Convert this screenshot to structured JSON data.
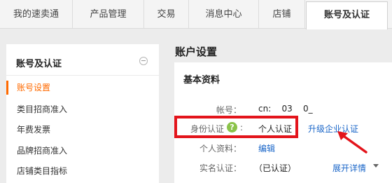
{
  "topnav": {
    "tabs": [
      {
        "label": "我的速卖通"
      },
      {
        "label": "产品管理"
      },
      {
        "label": "交易"
      },
      {
        "label": "消息中心"
      },
      {
        "label": "店铺"
      },
      {
        "label": "账号及认证",
        "active": true
      }
    ]
  },
  "sidebar": {
    "title": "账号及认证",
    "items": [
      {
        "label": "账号设置",
        "active": true
      },
      {
        "label": "类目招商准入"
      },
      {
        "label": "年费发票"
      },
      {
        "label": "品牌招商准入"
      },
      {
        "label": "店铺类目指标"
      }
    ]
  },
  "main": {
    "page_title": "账户设置",
    "section_title": "基本资料",
    "rows": {
      "account": {
        "label": "帐号：",
        "value": "cn:    03    0_"
      },
      "identity": {
        "label": "身份认证",
        "help_icon_text": "?",
        "colon": ":",
        "value": "个人认证",
        "action": "升级企业认证"
      },
      "profile": {
        "label": "个人资料：",
        "action": "编辑"
      },
      "realname": {
        "label": "实名认证：",
        "value": "（已认证）",
        "action": "展开详情"
      }
    }
  },
  "colors": {
    "accent": "#ff6a00",
    "link": "#1a66c8",
    "highlight": "#e3141b",
    "help_icon": "#8bc34a"
  }
}
